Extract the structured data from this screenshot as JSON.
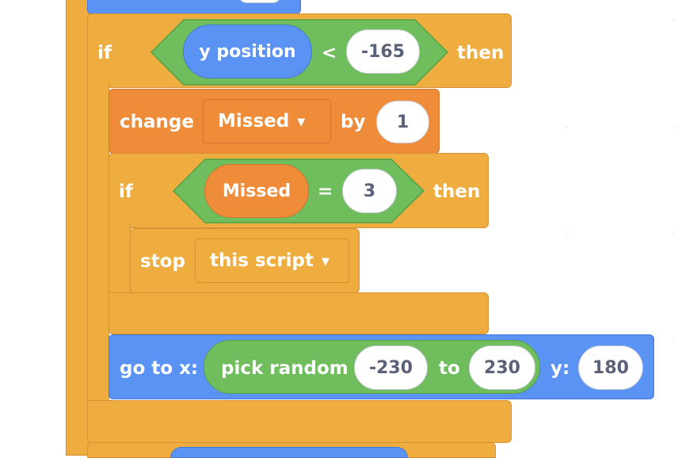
{
  "colors": {
    "control": "#f0ad3f",
    "variables": "#ef8c39",
    "motion": "#5b93f5",
    "operators": "#6fbd5d",
    "input": "#ffffff"
  },
  "if_outer": {
    "if": "if",
    "reporter": "y position",
    "op": "<",
    "value": "-165",
    "then": "then"
  },
  "change": {
    "change": "change",
    "variable": "Missed",
    "by": "by",
    "value": "1"
  },
  "if_inner": {
    "if": "if",
    "reporter": "Missed",
    "op": "=",
    "value": "3",
    "then": "then"
  },
  "stop": {
    "stop": "stop",
    "option": "this script"
  },
  "goto": {
    "goto": "go to x:",
    "pick": "pick random",
    "from": "-230",
    "to_label": "to",
    "to": "230",
    "y_label": "y:",
    "y": "180"
  },
  "icons": {
    "dropdown": "caret-down-icon"
  }
}
